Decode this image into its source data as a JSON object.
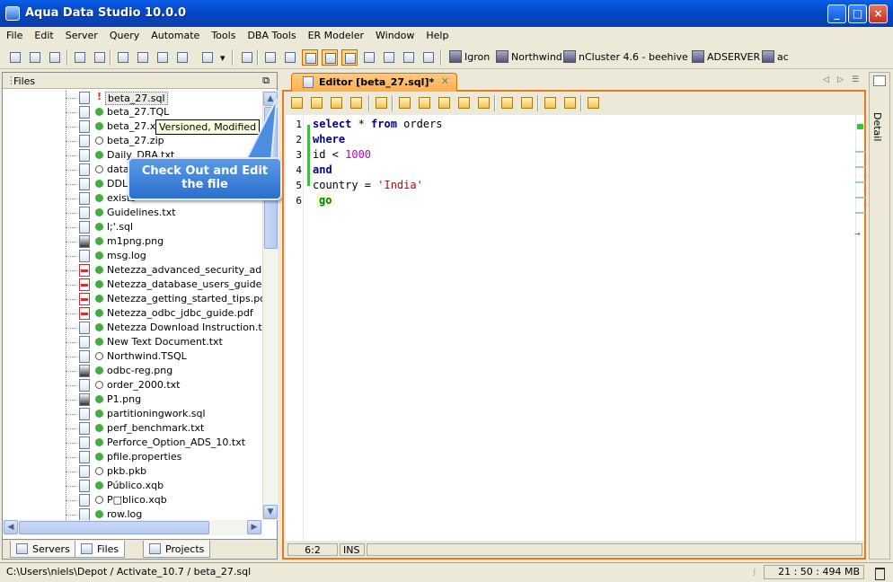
{
  "window": {
    "title": "Aqua Data Studio 10.0.0",
    "minimize": "_",
    "maximize": "□",
    "close": "×"
  },
  "menu": [
    "File",
    "Edit",
    "Server",
    "Query",
    "Automate",
    "Tools",
    "DBA Tools",
    "ER Modeler",
    "Window",
    "Help"
  ],
  "servers": [
    "Igron",
    "Northwind",
    "nCluster 4.6 - beehive -",
    "ADSERVER",
    "ac"
  ],
  "files_panel": {
    "title": "Files",
    "restore_icon": "restore-icon",
    "rows": [
      {
        "name": "beta_27.sql",
        "status": "!",
        "status_type": "modified",
        "icon": "sql-file-icon"
      },
      {
        "name": "beta_27.TQL",
        "status": "",
        "status_type": "ok",
        "icon": "sql-file-icon"
      },
      {
        "name": "beta_27.xjs",
        "status": "",
        "status_type": "ok",
        "icon": "script-file-icon"
      },
      {
        "name": "beta_27.zip",
        "status": "",
        "status_type": "none",
        "icon": "zip-file-icon"
      },
      {
        "name": "Daily_DBA.txt",
        "status": "",
        "status_type": "ok",
        "icon": "text-file-icon"
      },
      {
        "name": "datas",
        "status": "",
        "status_type": "none",
        "icon": "text-file-icon"
      },
      {
        "name": "DDL_",
        "status": "",
        "status_type": "ok",
        "icon": "text-file-icon"
      },
      {
        "name": "exists",
        "status": "",
        "status_type": "ok",
        "icon": "text-file-icon"
      },
      {
        "name": "Guidelines.txt",
        "status": "",
        "status_type": "ok",
        "icon": "text-file-icon"
      },
      {
        "name": "l;'.sql",
        "status": "",
        "status_type": "ok",
        "icon": "sql-file-icon"
      },
      {
        "name": "m1png.png",
        "status": "",
        "status_type": "ok",
        "icon": "image-file-icon"
      },
      {
        "name": "msg.log",
        "status": "",
        "status_type": "ok",
        "icon": "text-file-icon"
      },
      {
        "name": "Netezza_advanced_security_admin_",
        "status": "",
        "status_type": "ok",
        "icon": "pdf-file-icon"
      },
      {
        "name": "Netezza_database_users_guide.pdf",
        "status": "",
        "status_type": "ok",
        "icon": "pdf-file-icon"
      },
      {
        "name": "Netezza_getting_started_tips.pdf",
        "status": "",
        "status_type": "ok",
        "icon": "pdf-file-icon"
      },
      {
        "name": "Netezza_odbc_jdbc_guide.pdf",
        "status": "",
        "status_type": "ok",
        "icon": "pdf-file-icon"
      },
      {
        "name": "Netezza Download Instruction.txt",
        "status": "",
        "status_type": "ok",
        "icon": "text-file-icon"
      },
      {
        "name": "New Text Document.txt",
        "status": "",
        "status_type": "ok",
        "icon": "text-file-icon"
      },
      {
        "name": "Northwind.TSQL",
        "status": "",
        "status_type": "none",
        "icon": "text-file-icon"
      },
      {
        "name": "odbc-reg.png",
        "status": "",
        "status_type": "ok",
        "icon": "image-file-icon"
      },
      {
        "name": "order_2000.txt",
        "status": "",
        "status_type": "none",
        "icon": "text-file-icon"
      },
      {
        "name": "P1.png",
        "status": "",
        "status_type": "ok",
        "icon": "image-file-icon"
      },
      {
        "name": "partitioningwork.sql",
        "status": "",
        "status_type": "ok",
        "icon": "text-file-icon"
      },
      {
        "name": "perf_benchmark.txt",
        "status": "",
        "status_type": "ok",
        "icon": "text-file-icon"
      },
      {
        "name": "Perforce_Option_ADS_10.txt",
        "status": "",
        "status_type": "ok",
        "icon": "text-file-icon"
      },
      {
        "name": "pfile.properties",
        "status": "",
        "status_type": "ok",
        "icon": "text-file-icon"
      },
      {
        "name": "pkb.pkb",
        "status": "",
        "status_type": "none",
        "icon": "text-file-icon"
      },
      {
        "name": "Público.xqb",
        "status": "",
        "status_type": "ok",
        "icon": "query-file-icon"
      },
      {
        "name": "P□blico.xqb",
        "status": "",
        "status_type": "none",
        "icon": "query-file-icon"
      },
      {
        "name": "row.log",
        "status": "",
        "status_type": "ok",
        "icon": "text-file-icon"
      }
    ],
    "tabs": [
      "Servers",
      "Files",
      "Projects"
    ],
    "active_tab": "Files"
  },
  "tooltip": "Versioned, Modified",
  "callout": {
    "line1": "Check Out and Edit",
    "line2": "the file"
  },
  "editor": {
    "tab_label": "Editor [beta_27.sql]*",
    "lines": [
      {
        "num": "1",
        "parts": [
          {
            "t": "select",
            "c": "kw"
          },
          {
            "t": " * ",
            "c": ""
          },
          {
            "t": "from",
            "c": "kw"
          },
          {
            "t": " orders",
            "c": ""
          }
        ]
      },
      {
        "num": "2",
        "parts": [
          {
            "t": "where",
            "c": "kw"
          }
        ]
      },
      {
        "num": "3",
        "parts": [
          {
            "t": "id < ",
            "c": ""
          },
          {
            "t": "1000",
            "c": "num"
          }
        ]
      },
      {
        "num": "4",
        "parts": [
          {
            "t": "and",
            "c": "kw"
          }
        ]
      },
      {
        "num": "5",
        "parts": [
          {
            "t": "country = ",
            "c": ""
          },
          {
            "t": "'India'",
            "c": "str"
          }
        ]
      },
      {
        "num": "6",
        "parts": [
          {
            "t": "go",
            "c": "go"
          }
        ]
      }
    ],
    "cursor": "6:2",
    "mode": "INS"
  },
  "detail_label": "Detail",
  "statusbar": {
    "path": "C:\\Users\\niels\\Depot / Activate_10.7 / beta_27.sql",
    "memory": "21 : 50 : 494 MB"
  }
}
